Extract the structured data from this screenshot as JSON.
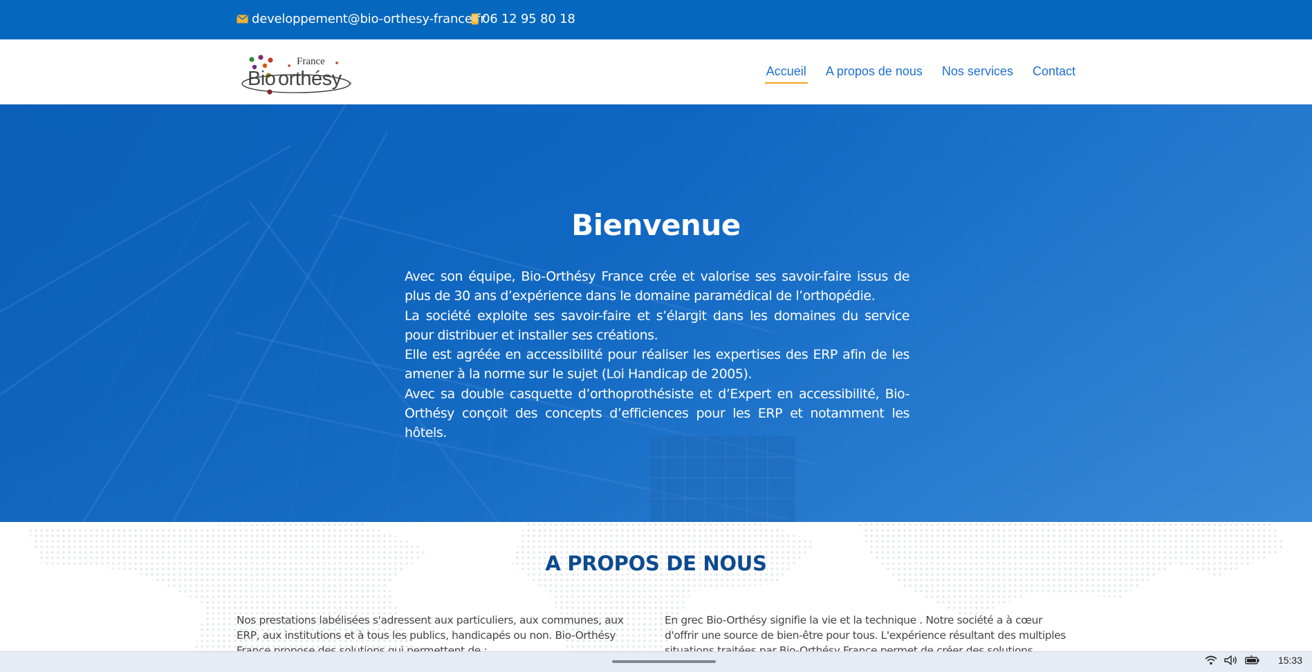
{
  "topbar": {
    "email": "developpement@bio-orthesy-france.fr",
    "phone": "06 12 95 80 18",
    "bg_color": "#0567bd",
    "icons": {
      "email": "envelope-icon",
      "phone": "mobile-phone-icon"
    }
  },
  "brand": {
    "logo_alt": "France Bio-orthésy"
  },
  "nav": {
    "items": [
      {
        "label": "Accueil",
        "active": true
      },
      {
        "label": "A propos de nous",
        "active": false
      },
      {
        "label": "Nos services",
        "active": false
      },
      {
        "label": "Contact",
        "active": false
      }
    ],
    "link_color": "#1f6fd2",
    "active_underline_color": "#f0a020"
  },
  "hero": {
    "title": "Bienvenue",
    "paragraphs": [
      "Avec son équipe, Bio-Orthésy France crée et valorise ses savoir-faire issus de plus de 30 ans d’expérience dans le domaine paramédical de l’orthopédie.",
      "La société exploite ses savoir-faire et s’élargit dans les domaines du service pour distribuer et installer ses créations.",
      "Elle est agréée en accessibilité pour réaliser les expertises des ERP afin de les amener à la norme sur le sujet (Loi Handicap de 2005).",
      "Avec sa double casquette d’orthoprothésiste et d’Expert en accessibilité, Bio-Orthésy conçoit des concepts d’efficiences pour les ERP et notamment les hôtels."
    ],
    "bg_color": "#0d66c2"
  },
  "about": {
    "heading": "A PROPOS DE NOUS",
    "left_text": "Nos prestations labélisées s'adressent aux particuliers, aux communes, aux ERP, aux institutions et à tous les publics, handicapés ou non. Bio-Orthésy France propose des solutions qui permettent de :",
    "right_text": "En grec Bio-Orthésy signifie la vie et la technique . Notre société a à cœur d'offrir une source de bien-être pour tous. L'expérience résultant des multiples situations traitées par Bio-Orthésy France permet de créer des solutions originales et sur",
    "heading_color": "#0d4a8f"
  },
  "taskbar": {
    "clock": "15:33",
    "tray_icons": [
      "wifi-icon",
      "volume-icon",
      "battery-icon"
    ]
  }
}
